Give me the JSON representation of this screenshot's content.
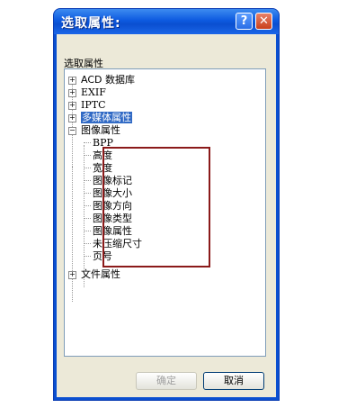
{
  "window": {
    "title": "选取属性:",
    "help_label": "?",
    "close_label": "✕"
  },
  "group_label": "选取属性",
  "tree": {
    "acd_db": "ACD 数据库",
    "exif": "EXIF",
    "iptc": "IPTC",
    "multimedia": "多媒体属性",
    "image_props": "图像属性",
    "children": [
      "BPP",
      "高度",
      "宽度",
      "图像标记",
      "图像大小",
      "图像方向",
      "图像类型",
      "图像属性",
      "未压缩尺寸",
      "页号"
    ],
    "file_props": "文件属性",
    "expand_symbol": "+",
    "collapse_symbol": "−"
  },
  "buttons": {
    "ok": "确定",
    "cancel": "取消"
  },
  "colors": {
    "titlebar": "#0a4fd0",
    "selection": "#316ac5",
    "highlight_box": "#8b1a1a"
  }
}
